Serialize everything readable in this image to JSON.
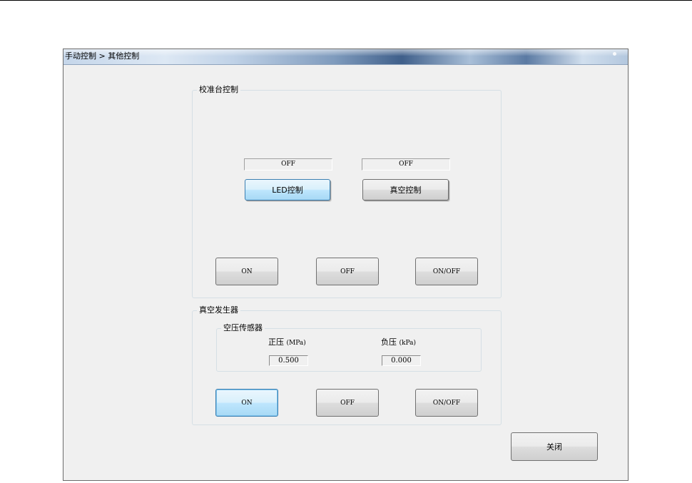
{
  "window": {
    "title": "手动控制 > 其他控制"
  },
  "calibration": {
    "group_label": "校准台控制",
    "led": {
      "status": "OFF",
      "button_label": "LED控制"
    },
    "vacuum": {
      "status": "OFF",
      "button_label": "真空控制"
    },
    "buttons": {
      "on": "ON",
      "off": "OFF",
      "on_off": "ON/OFF"
    }
  },
  "vacuum_generator": {
    "group_label": "真空发生器",
    "sensor": {
      "group_label": "空压传感器",
      "positive": {
        "label": "正压",
        "unit": "(MPa)",
        "value": "0.500"
      },
      "negative": {
        "label": "负压",
        "unit": "(kPa)",
        "value": "0.000"
      }
    },
    "buttons": {
      "on": "ON",
      "off": "OFF",
      "on_off": "ON/OFF"
    }
  },
  "footer": {
    "close_label": "关闭"
  }
}
